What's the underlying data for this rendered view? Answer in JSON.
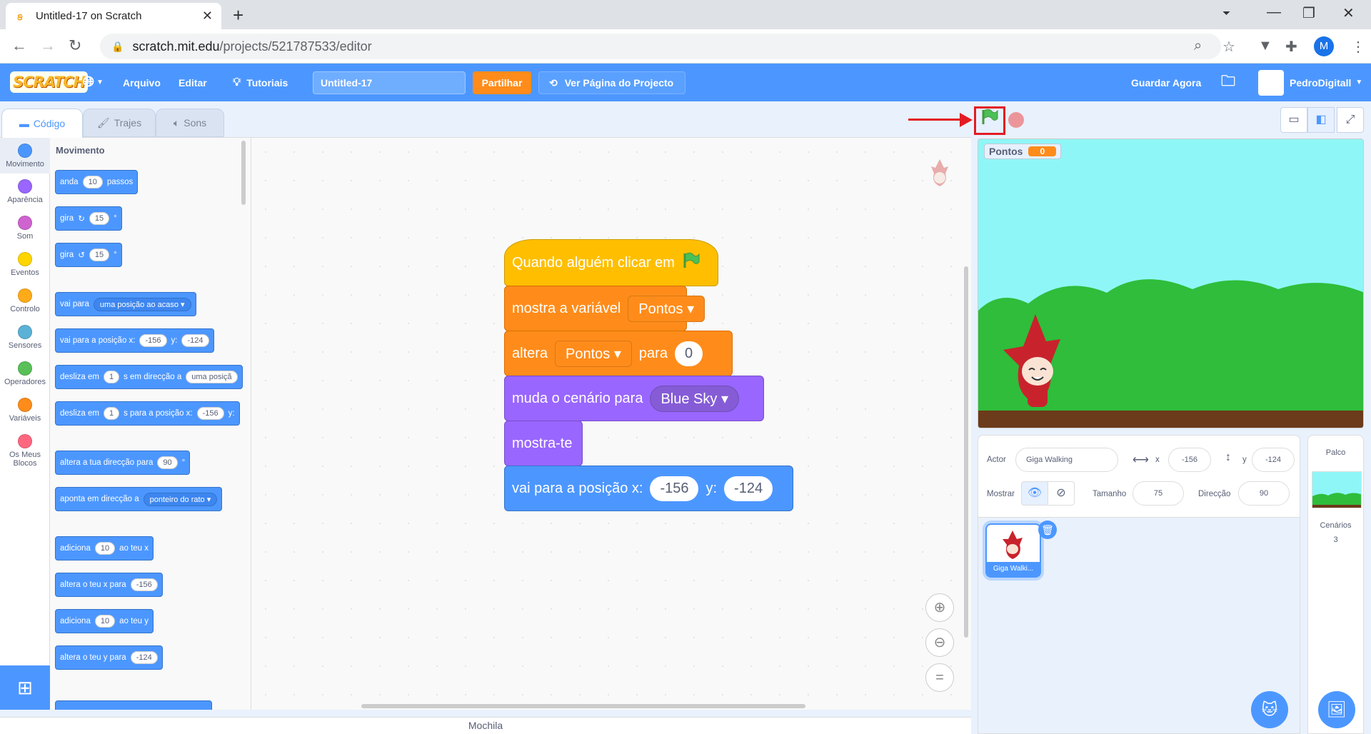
{
  "browser": {
    "tab_title": "Untitled-17 on Scratch",
    "url_host": "scratch.mit.edu",
    "url_path": "/projects/521787533/editor",
    "profile_initial": "M"
  },
  "menu": {
    "logo": "SCRATCH",
    "file": "Arquivo",
    "edit": "Editar",
    "tutorials": "Tutoriais",
    "project_title": "Untitled-17",
    "share": "Partilhar",
    "project_page": "Ver Página do Projecto",
    "save_now": "Guardar Agora",
    "username": "PedroDigitall"
  },
  "tabs": {
    "code": "Código",
    "costumes": "Trajes",
    "sounds": "Sons"
  },
  "categories": [
    {
      "label": "Movimento",
      "color": "#4c97ff"
    },
    {
      "label": "Aparência",
      "color": "#9966ff"
    },
    {
      "label": "Som",
      "color": "#cf63cf"
    },
    {
      "label": "Eventos",
      "color": "#ffd500"
    },
    {
      "label": "Controlo",
      "color": "#ffab19"
    },
    {
      "label": "Sensores",
      "color": "#5cb1d6"
    },
    {
      "label": "Operadores",
      "color": "#59c059"
    },
    {
      "label": "Variáveis",
      "color": "#ff8c1a"
    },
    {
      "label": "Os Meus Blocos",
      "color": "#ff6680"
    }
  ],
  "palette": {
    "heading": "Movimento",
    "move": {
      "a": "anda",
      "n": "10",
      "b": "passos"
    },
    "turn_right": {
      "a": "gira",
      "n": "15",
      "b": "°"
    },
    "turn_left": {
      "a": "gira",
      "n": "15",
      "b": "°"
    },
    "goto": {
      "a": "vai para",
      "dd": "uma posição ao acaso"
    },
    "goto_xy": {
      "a": "vai para a posição x:",
      "x": "-156",
      "y_label": "y:",
      "y": "-124"
    },
    "glide": {
      "a": "desliza em",
      "n": "1",
      "b": "s em direcção a",
      "dd": "uma posiçã"
    },
    "glide_xy": {
      "a": "desliza em",
      "n": "1",
      "b": "s para a posição x:",
      "x": "-156",
      "y_label": "y:"
    },
    "point_dir": {
      "a": "altera a tua direcção para",
      "n": "90",
      "b": "°"
    },
    "point_towards": {
      "a": "aponta em direcção a",
      "dd": "ponteiro do rato"
    },
    "change_x": {
      "a": "adiciona",
      "n": "10",
      "b": "ao teu x"
    },
    "set_x": {
      "a": "altera o teu x para",
      "n": "-156"
    },
    "change_y": {
      "a": "adiciona",
      "n": "10",
      "b": "ao teu y"
    },
    "set_y": {
      "a": "altera o teu y para",
      "n": "-124"
    }
  },
  "script": {
    "hat": "Quando alguém clicar em",
    "show_var": {
      "a": "mostra a variável",
      "dd": "Pontos"
    },
    "set_var": {
      "a": "altera",
      "dd": "Pontos",
      "b": "para",
      "v": "0"
    },
    "switch_bg": {
      "a": "muda o cenário para",
      "dd": "Blue Sky"
    },
    "show": "mostra-te",
    "goto_xy": {
      "a": "vai para a posição x:",
      "x": "-156",
      "y_label": "y:",
      "y": "-124"
    }
  },
  "backpack": "Mochila",
  "stage": {
    "monitor_label": "Pontos",
    "monitor_value": "0"
  },
  "sprite_info": {
    "sprite_label": "Actor",
    "sprite_name": "Giga Walking",
    "x_label": "x",
    "x": "-156",
    "y_label": "y",
    "y": "-124",
    "show_label": "Mostrar",
    "size_label": "Tamanho",
    "size": "75",
    "direction_label": "Direcção",
    "direction": "90"
  },
  "sprite_list": [
    {
      "name": "Giga Walki..."
    }
  ],
  "stage_pane": {
    "title": "Palco",
    "backdrops_label": "Cenários",
    "backdrops_count": "3"
  }
}
